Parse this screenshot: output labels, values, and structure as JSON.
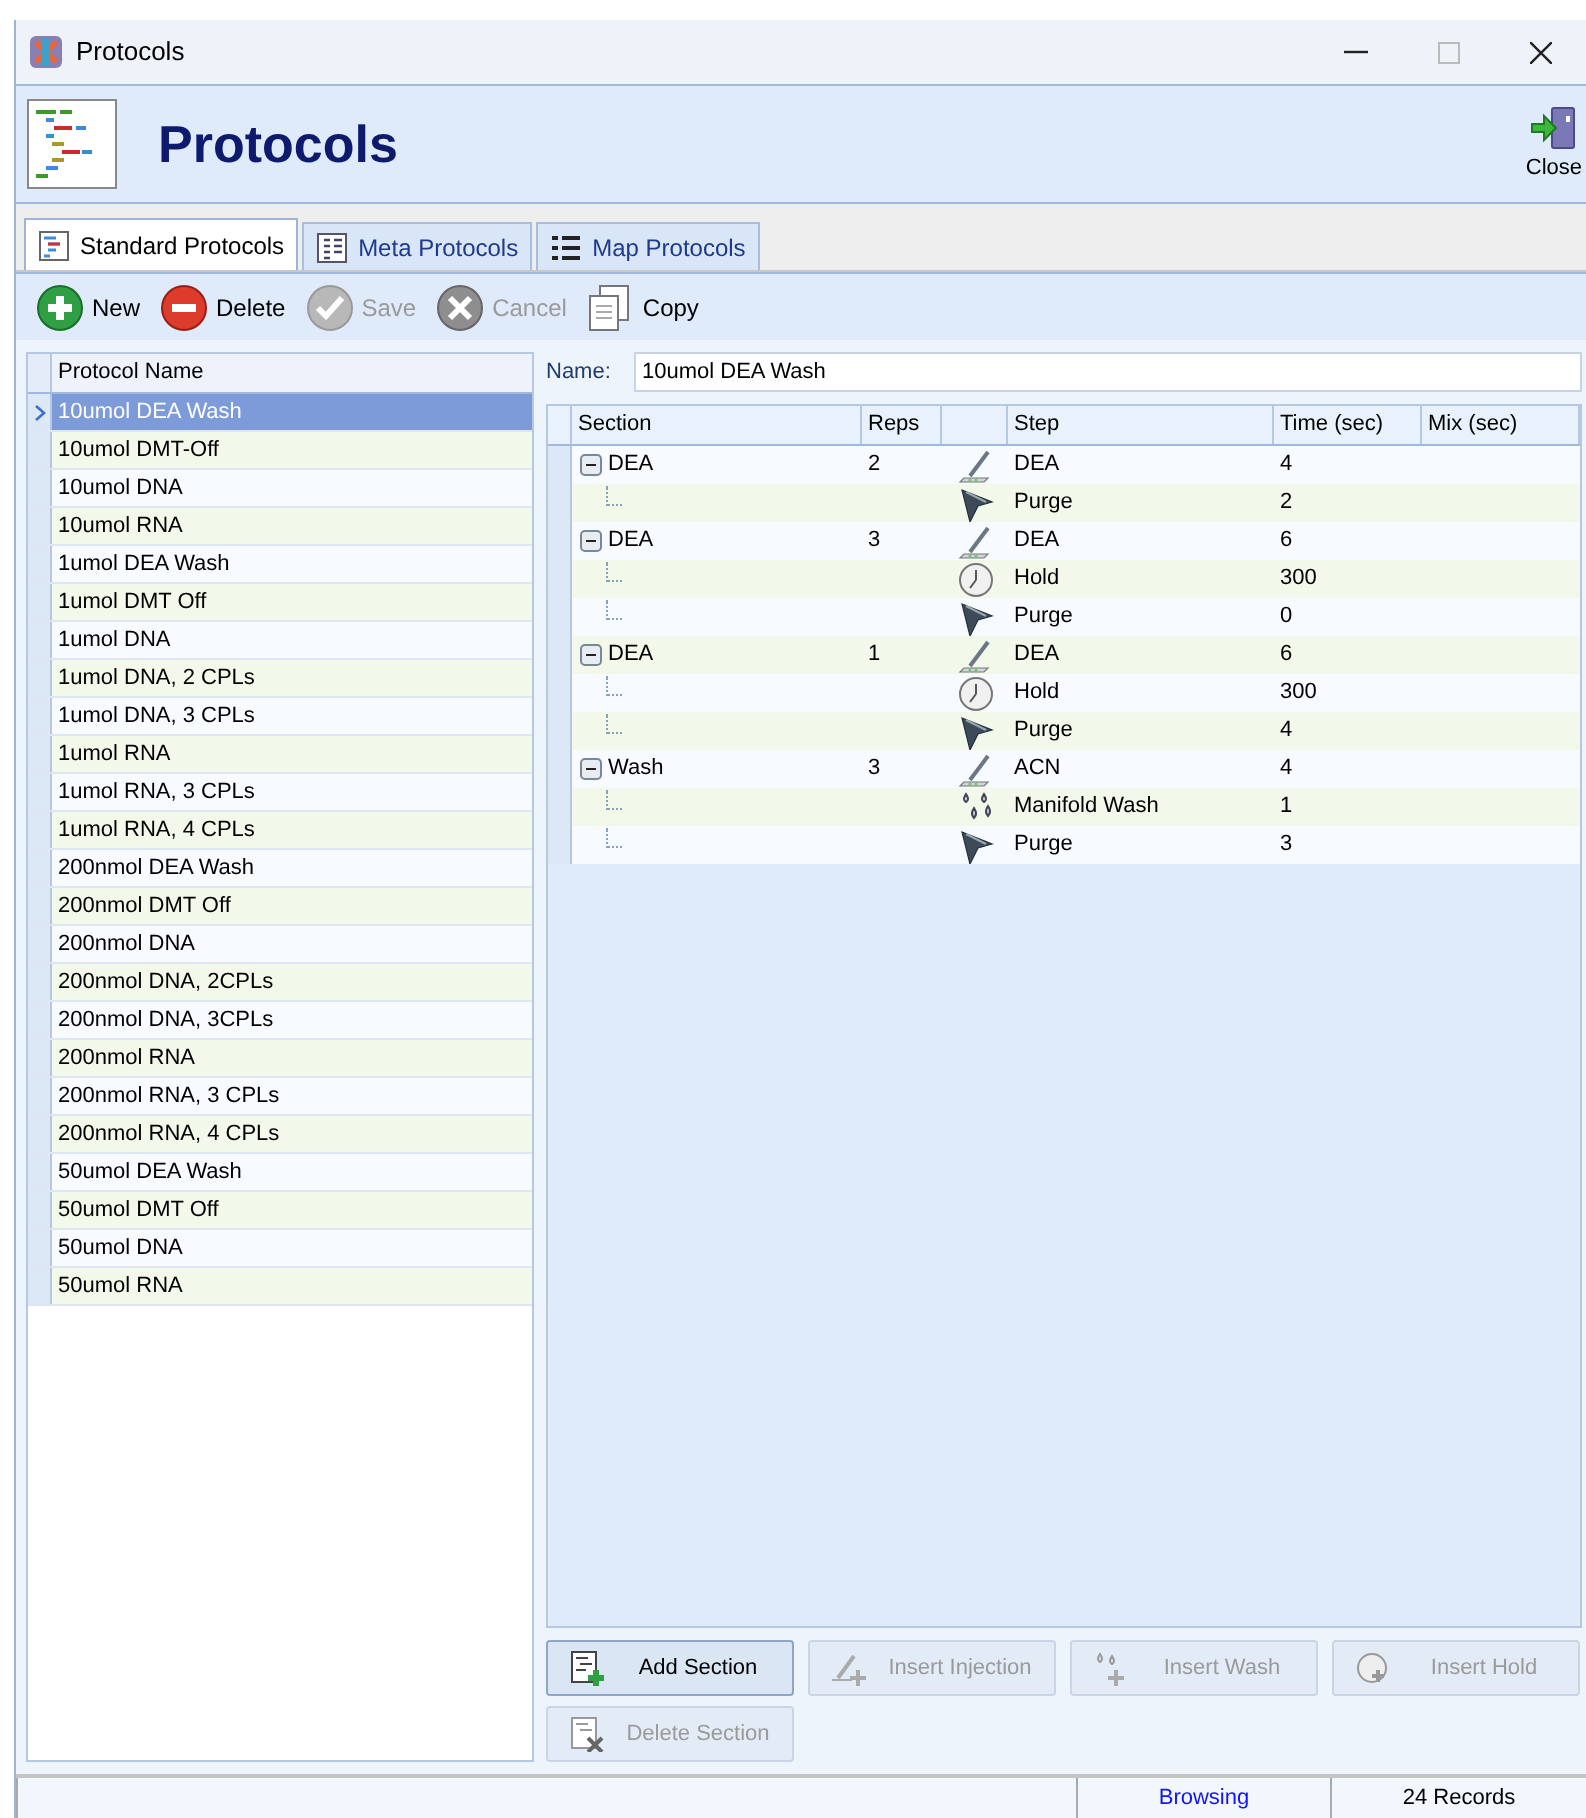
{
  "window": {
    "title": "Protocols"
  },
  "header": {
    "title": "Protocols",
    "close_label": "Close"
  },
  "tabs": [
    {
      "label": "Standard Protocols",
      "selected": true
    },
    {
      "label": "Meta Protocols",
      "selected": false
    },
    {
      "label": "Map Protocols",
      "selected": false
    }
  ],
  "toolbar": [
    {
      "label": "New",
      "kind": "new",
      "disabled": false
    },
    {
      "label": "Delete",
      "kind": "delete",
      "disabled": false
    },
    {
      "label": "Save",
      "kind": "save",
      "disabled": true
    },
    {
      "label": "Cancel",
      "kind": "cancel",
      "disabled": true
    },
    {
      "label": "Copy",
      "kind": "copy",
      "disabled": false
    }
  ],
  "protocol_list": {
    "column": "Protocol Name",
    "rows": [
      {
        "name": "10umol DEA Wash",
        "selected": true
      },
      {
        "name": "10umol DMT-Off",
        "selected": false
      },
      {
        "name": "10umol DNA",
        "selected": false
      },
      {
        "name": "10umol RNA",
        "selected": false
      },
      {
        "name": "1umol DEA Wash",
        "selected": false
      },
      {
        "name": "1umol DMT Off",
        "selected": false
      },
      {
        "name": "1umol DNA",
        "selected": false
      },
      {
        "name": "1umol DNA, 2 CPLs",
        "selected": false
      },
      {
        "name": "1umol DNA, 3 CPLs",
        "selected": false
      },
      {
        "name": "1umol RNA",
        "selected": false
      },
      {
        "name": "1umol RNA, 3 CPLs",
        "selected": false
      },
      {
        "name": "1umol RNA, 4 CPLs",
        "selected": false
      },
      {
        "name": "200nmol DEA Wash",
        "selected": false
      },
      {
        "name": "200nmol DMT Off",
        "selected": false
      },
      {
        "name": "200nmol DNA",
        "selected": false
      },
      {
        "name": "200nmol DNA, 2CPLs",
        "selected": false
      },
      {
        "name": "200nmol DNA, 3CPLs",
        "selected": false
      },
      {
        "name": "200nmol RNA",
        "selected": false
      },
      {
        "name": "200nmol RNA, 3 CPLs",
        "selected": false
      },
      {
        "name": "200nmol RNA, 4 CPLs",
        "selected": false
      },
      {
        "name": "50umol DEA Wash",
        "selected": false
      },
      {
        "name": "50umol DMT Off",
        "selected": false
      },
      {
        "name": "50umol DNA",
        "selected": false
      },
      {
        "name": "50umol RNA",
        "selected": false
      }
    ]
  },
  "name_field": {
    "label": "Name:",
    "value": "10umol DEA Wash"
  },
  "sections_grid": {
    "columns": [
      "Section",
      "Reps",
      "Step",
      "Time (sec)",
      "Mix (sec)"
    ],
    "sections": [
      {
        "section": "DEA",
        "reps": "2",
        "expanded": true,
        "children": [
          {
            "kind": "inject",
            "step": "DEA",
            "time": "4"
          },
          {
            "kind": "purge",
            "step": "Purge",
            "time": "2"
          }
        ]
      },
      {
        "section": "DEA",
        "reps": "3",
        "expanded": true,
        "children": [
          {
            "kind": "inject",
            "step": "DEA",
            "time": "6"
          },
          {
            "kind": "hold",
            "step": "Hold",
            "time": "300"
          },
          {
            "kind": "purge",
            "step": "Purge",
            "time": "0"
          }
        ]
      },
      {
        "section": "DEA",
        "reps": "1",
        "expanded": true,
        "children": [
          {
            "kind": "inject",
            "step": "DEA",
            "time": "6"
          },
          {
            "kind": "hold",
            "step": "Hold",
            "time": "300"
          },
          {
            "kind": "purge",
            "step": "Purge",
            "time": "4"
          }
        ]
      },
      {
        "section": "Wash",
        "reps": "3",
        "expanded": true,
        "children": [
          {
            "kind": "inject",
            "step": "ACN",
            "time": "4"
          },
          {
            "kind": "wash",
            "step": "Manifold Wash",
            "time": "1"
          },
          {
            "kind": "purge",
            "step": "Purge",
            "time": "3"
          }
        ]
      }
    ]
  },
  "action_buttons": [
    {
      "label": "Add Section",
      "kind": "add",
      "disabled": false
    },
    {
      "label": "Insert Injection",
      "kind": "inject",
      "disabled": true
    },
    {
      "label": "Insert Wash",
      "kind": "wash",
      "disabled": true
    },
    {
      "label": "Insert Hold",
      "kind": "hold",
      "disabled": true
    },
    {
      "label": "Delete Section",
      "kind": "delete",
      "disabled": true
    }
  ],
  "status_bar": {
    "mode": "Browsing",
    "records": "24 Records"
  }
}
